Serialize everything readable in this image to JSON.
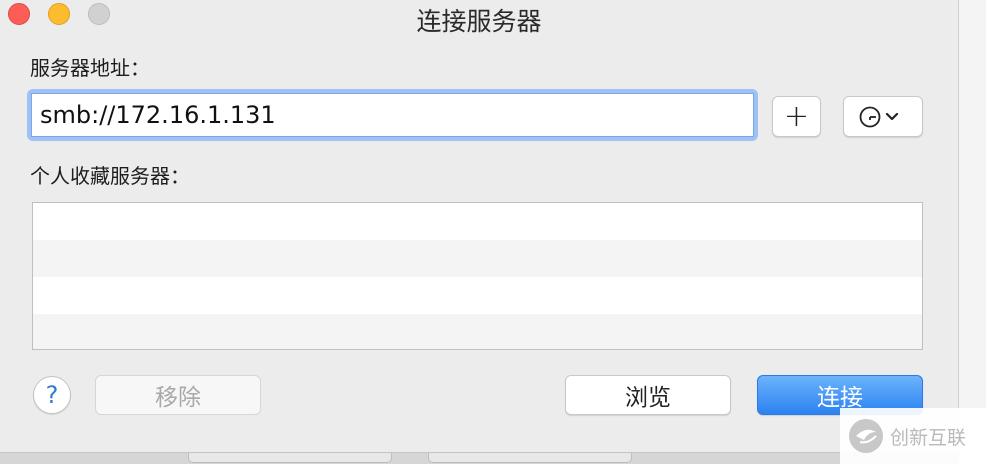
{
  "window": {
    "title": "连接服务器"
  },
  "address": {
    "label": "服务器地址：",
    "value": "smb://172.16.1.131"
  },
  "toolbar": {
    "add_label": "+",
    "recent_icon": "clock-icon",
    "recent_chevron": "chevron-down-icon"
  },
  "favorites": {
    "label": "个人收藏服务器：",
    "rows": [
      "",
      "",
      "",
      ""
    ]
  },
  "footer": {
    "help_label": "?",
    "remove_label": "移除",
    "browse_label": "浏览",
    "connect_label": "连接"
  },
  "watermark": {
    "text": "创新互联"
  },
  "colors": {
    "accent": "#2b82f2",
    "traffic_close": "#fc5d56",
    "traffic_min": "#fdbc2e"
  }
}
